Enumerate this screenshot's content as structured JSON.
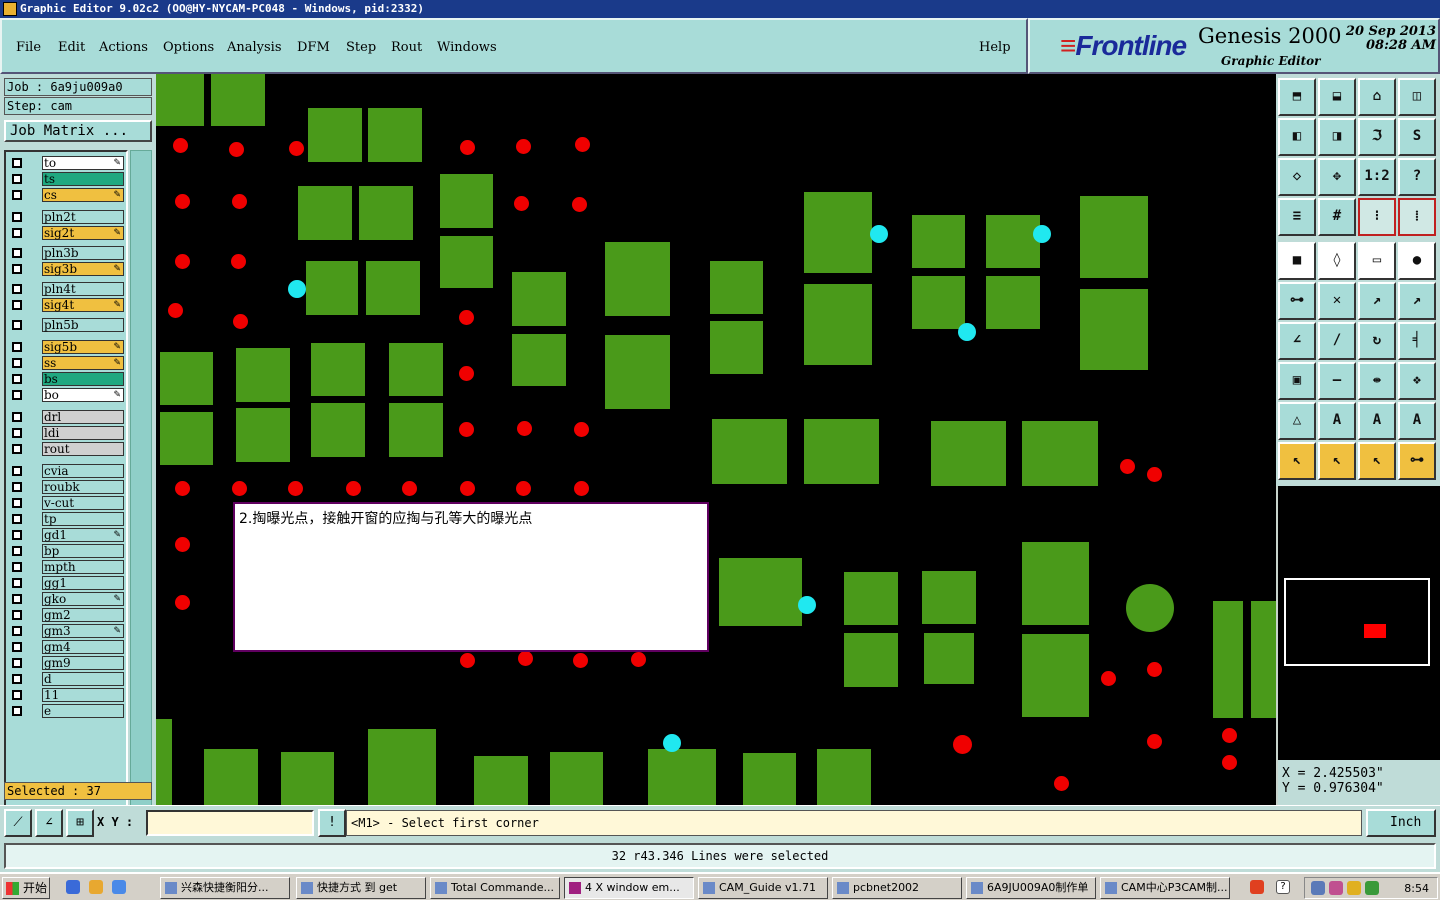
{
  "title_bar": "Graphic Editor 9.02c2 (OO@HY-NYCAM-PC048 - Windows, pid:2332)",
  "menu": [
    "File",
    "Edit",
    "Actions",
    "Options",
    "Analysis",
    "DFM",
    "Step",
    "Rout",
    "Windows"
  ],
  "help": "Help",
  "brand": {
    "logo": "Frontline",
    "product": "Genesis 2000",
    "subtitle": "Graphic Editor",
    "date": "20 Sep 2013",
    "time": "08:28 AM"
  },
  "job": {
    "job_label": "Job : 6a9ju009a0",
    "step_label": "Step: cam",
    "matrix_button": "Job Matrix ..."
  },
  "layers": [
    {
      "name": "to",
      "color": "#ffffff",
      "writable": true
    },
    {
      "name": "ts",
      "color": "#20a880",
      "writable": false
    },
    {
      "name": "cs",
      "color": "#f0c040",
      "writable": true
    },
    {
      "name": "pln2t",
      "color": "#a8dcd8",
      "writable": false
    },
    {
      "name": "sig2t",
      "color": "#f0c040",
      "writable": true
    },
    {
      "name": "pln3b",
      "color": "#a8dcd8",
      "writable": false
    },
    {
      "name": "sig3b",
      "color": "#f0c040",
      "writable": true
    },
    {
      "name": "pln4t",
      "color": "#a8dcd8",
      "writable": false
    },
    {
      "name": "sig4t",
      "color": "#f0c040",
      "writable": true
    },
    {
      "name": "pln5b",
      "color": "#a8dcd8",
      "writable": false
    },
    {
      "name": "sig5b",
      "color": "#f0c040",
      "writable": true
    },
    {
      "name": "ss",
      "color": "#f0c040",
      "writable": true
    },
    {
      "name": "bs",
      "color": "#20a880",
      "writable": false
    },
    {
      "name": "bo",
      "color": "#ffffff",
      "writable": true
    },
    {
      "name": "drl",
      "color": "#d0d0d0",
      "writable": false
    },
    {
      "name": "ldi",
      "color": "#d0d0d0",
      "writable": false
    },
    {
      "name": "rout",
      "color": "#d0d0d0",
      "writable": false
    },
    {
      "name": "cvia",
      "color": "#a8dcd8",
      "writable": false
    },
    {
      "name": "roubk",
      "color": "#a8dcd8",
      "writable": false
    },
    {
      "name": "v-cut",
      "color": "#a8dcd8",
      "writable": false
    },
    {
      "name": "tp",
      "color": "#a8dcd8",
      "writable": false
    },
    {
      "name": "gd1",
      "color": "#a8dcd8",
      "writable": true
    },
    {
      "name": "bp",
      "color": "#a8dcd8",
      "writable": false
    },
    {
      "name": "mpth",
      "color": "#a8dcd8",
      "writable": false
    },
    {
      "name": "gg1",
      "color": "#a8dcd8",
      "writable": false
    },
    {
      "name": "gko",
      "color": "#a8dcd8",
      "writable": true
    },
    {
      "name": "gm2",
      "color": "#a8dcd8",
      "writable": false
    },
    {
      "name": "gm3",
      "color": "#a8dcd8",
      "writable": true
    },
    {
      "name": "gm4",
      "color": "#a8dcd8",
      "writable": false
    },
    {
      "name": "gm9",
      "color": "#a8dcd8",
      "writable": false
    },
    {
      "name": "d",
      "color": "#a8dcd8",
      "writable": false
    },
    {
      "name": "11",
      "color": "#a8dcd8",
      "writable": false
    },
    {
      "name": "e",
      "color": "#a8dcd8",
      "writable": false
    }
  ],
  "selected_label": "Selected : 37",
  "note_text": "2.掏曝光点，接触开窗的应掏与孔等大的曝光点",
  "coords": {
    "x": "X = 2.425503\"",
    "y": "Y = 0.976304\""
  },
  "command": {
    "xy_label": "X Y :",
    "xy_value": "",
    "prompt": "<M1> - Select first corner",
    "unit": "Inch"
  },
  "status_message": "32 r43.346 Lines were selected",
  "taskbar": {
    "start": "开始",
    "tasks": [
      "兴森快捷衡阳分...",
      "快捷方式 到 get",
      "Total Commande...",
      "4 X window em...",
      "CAM_Guide v1.71",
      "pcbnet2002",
      "6A9JU009A0制作单",
      "CAM中心P3CAM制..."
    ],
    "clock": "8:54"
  },
  "colors": {
    "pad": "#4a9a1a",
    "drill": "#f00000",
    "via": "#20e8f0",
    "panel": "#a8dcd8"
  }
}
